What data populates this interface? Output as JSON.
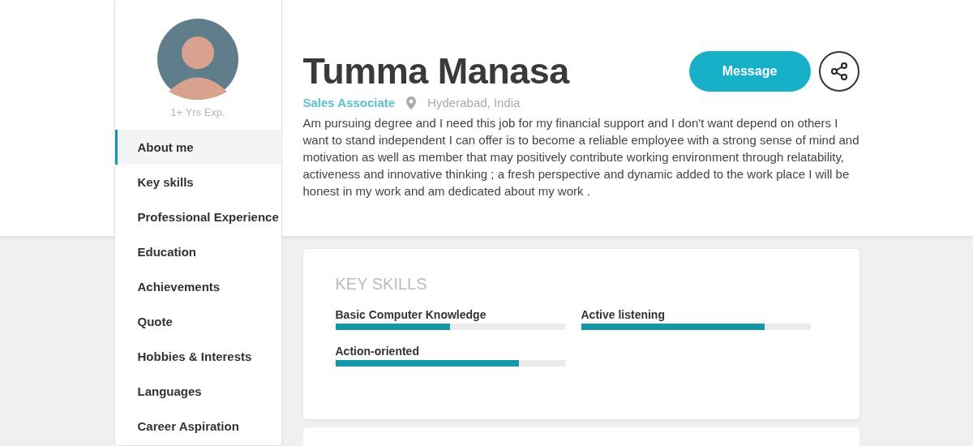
{
  "profile": {
    "experience": "1+ Yrs Exp.",
    "name": "Tumma Manasa",
    "title": "Sales Associate",
    "location": "Hyderabad, India",
    "bio": "Am pursuing degree and I need this job for my financial support and I don't want depend on others I want to stand independent I can offer is to become a reliable employee with a strong sense of mind and motivation as well as member that may positively contribute working environment through relatability, activeness and innovative thinking ; a fresh perspective and dynamic added to the work place I will be honest in my work and am dedicated about my work ."
  },
  "actions": {
    "message": "Message"
  },
  "sidebar": {
    "items": [
      {
        "label": "About me",
        "selected": true
      },
      {
        "label": "Key skills",
        "selected": false
      },
      {
        "label": "Professional Experience",
        "selected": false
      },
      {
        "label": "Education",
        "selected": false
      },
      {
        "label": "Achievements",
        "selected": false
      },
      {
        "label": "Quote",
        "selected": false
      },
      {
        "label": "Hobbies & Interests",
        "selected": false
      },
      {
        "label": "Languages",
        "selected": false
      },
      {
        "label": "Career Aspiration",
        "selected": false
      }
    ]
  },
  "key_skills": {
    "title": "KEY SKILLS",
    "skills": [
      {
        "name": "Basic Computer Knowledge",
        "level": 0.5
      },
      {
        "name": "Active listening",
        "level": 0.8
      },
      {
        "name": "Action-oriented",
        "level": 0.8
      }
    ]
  }
}
